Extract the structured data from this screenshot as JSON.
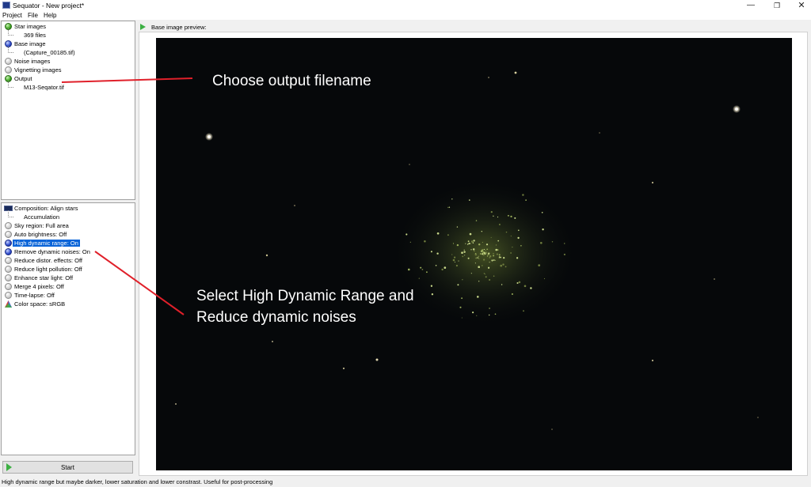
{
  "window": {
    "title": "Sequator - New project*",
    "controls": {
      "minimize": "—",
      "maximize": "❐",
      "close": "✕"
    }
  },
  "menu": [
    "Project",
    "File",
    "Help"
  ],
  "inputs_tree": {
    "star_images": {
      "label": "Star images",
      "icon": "green-ball",
      "child": "369 files"
    },
    "base_image": {
      "label": "Base image",
      "icon": "blue-ball",
      "child": "(Capture_00185.tif)"
    },
    "noise_images": {
      "label": "Noise images",
      "icon": "gray-ball"
    },
    "vignetting_images": {
      "label": "Vignetting images",
      "icon": "gray-ball"
    },
    "output": {
      "label": "Output",
      "icon": "green-ball",
      "child": "M13-Seqator.tif"
    }
  },
  "settings_tree": {
    "composition": {
      "label": "Composition: Align stars",
      "child": "Accumulation"
    },
    "items": [
      {
        "label": "Sky region: Full area",
        "icon": "gray-ball"
      },
      {
        "label": "Auto brightness: Off",
        "icon": "gray-ball"
      },
      {
        "label": "High dynamic range: On",
        "icon": "blue-ball",
        "selected": true
      },
      {
        "label": "Remove dynamic noises: On",
        "icon": "blue-ball"
      },
      {
        "label": "Reduce distor. effects: Off",
        "icon": "gray-ball"
      },
      {
        "label": "Reduce light pollution: Off",
        "icon": "gray-ball"
      },
      {
        "label": "Enhance star light: Off",
        "icon": "gray-ball"
      },
      {
        "label": "Merge 4 pixels: Off",
        "icon": "gray-ball"
      },
      {
        "label": "Time-lapse: Off",
        "icon": "gray-ball"
      }
    ],
    "color_space": {
      "label": "Color space: sRGB",
      "icon": "palette-icon"
    }
  },
  "start_button": "Start",
  "preview": {
    "label": "Base image preview:"
  },
  "annotations": {
    "output": "Choose output filename",
    "hdr_line1": "Select High Dynamic Range and",
    "hdr_line2": "Reduce dynamic noises"
  },
  "status_bar": "High dynamic range but maybe darker, lower saturation and lower constrast. Useful for post-processing",
  "colors": {
    "selection": "#0a64d8",
    "annotation_line": "#e0202a",
    "sky": "#06080a"
  }
}
